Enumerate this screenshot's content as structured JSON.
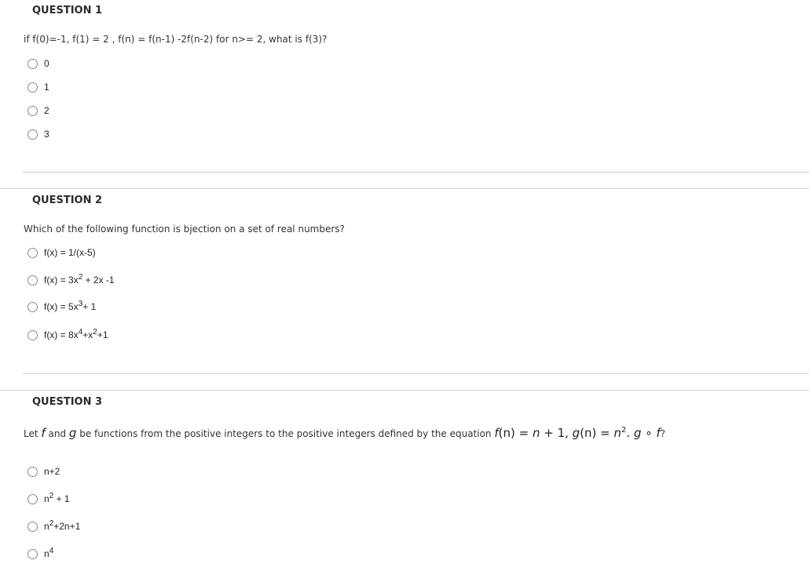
{
  "questions": [
    {
      "title": "QUESTION 1",
      "text": "if  f(0)=-1,  f(1) = 2  , f(n) = f(n-1) -2f(n-2)  for n>= 2, what is f(3)?",
      "options": [
        {
          "label": "0",
          "selected": false
        },
        {
          "label": "1",
          "selected": false
        },
        {
          "label": "2",
          "selected": false
        },
        {
          "label": "3",
          "selected": false
        }
      ]
    },
    {
      "title": "QUESTION 2",
      "text": "Which of the following function is bjection on a set of real numbers?",
      "options": [
        {
          "base": "f(x) = 1/(x-5)",
          "selected": false
        },
        {
          "base": "f(x) = 3x",
          "sup": "2",
          "rest": " + 2x -1",
          "selected": false
        },
        {
          "base": "f(x) = 5x",
          "sup": "3",
          "rest": "+ 1",
          "selected": false
        },
        {
          "base": "f(x) = 8x",
          "sup": "4",
          "rest": "+x",
          "sup2": "2",
          "rest2": "+1",
          "selected": false
        }
      ]
    },
    {
      "title": "QUESTION 3",
      "text_parts": {
        "p1": "Let ",
        "f": "f",
        "p2": " and ",
        "g": "g",
        "p3": " be functions from the positive integers to the positive integers defined by the equation ",
        "eq1_f": "f",
        "eq1_rest": "(n) = ",
        "eq1_n": "n",
        "eq1_tail": " + 1, ",
        "eq2_g": "g",
        "eq2_rest": "(n) = ",
        "eq2_n": "n",
        "eq2_sup": "2",
        "eq2_tail": ". ",
        "comp_g": "g",
        "comp_op": " ∘ ",
        "comp_f": "f",
        "q": "?"
      },
      "options": [
        {
          "base": "n+2",
          "selected": false
        },
        {
          "base": "n",
          "sup": "2",
          "rest": " + 1",
          "selected": false
        },
        {
          "base": "n",
          "sup": "2",
          "rest": "+2n+1",
          "selected": false
        },
        {
          "base": "n",
          "sup": "4",
          "rest": "",
          "selected": false
        }
      ]
    }
  ]
}
